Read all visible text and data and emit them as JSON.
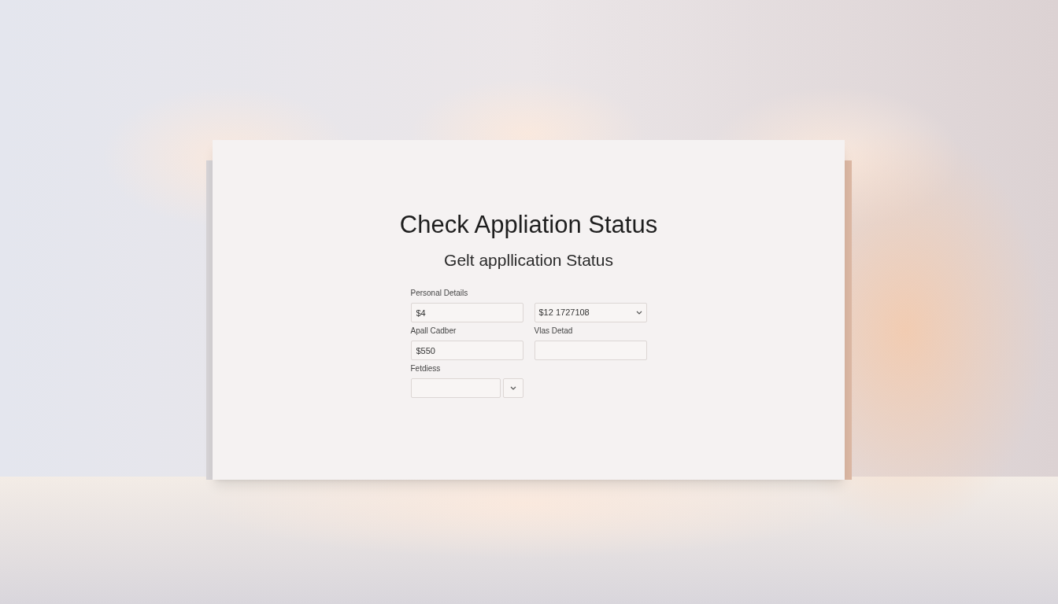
{
  "title": "Check Appliation Status",
  "subtitle": "Gelt appllication Status",
  "fields": [
    {
      "kind": "text",
      "label": "Personal Details",
      "value": "$4"
    },
    {
      "kind": "select",
      "value": "$12 1727108"
    },
    {
      "kind": "text",
      "label": "Apall Cadber",
      "value": "$550"
    },
    {
      "kind": "text",
      "label": "Vlas Detad"
    },
    {
      "kind": "split",
      "label": "Fetdiess"
    }
  ]
}
